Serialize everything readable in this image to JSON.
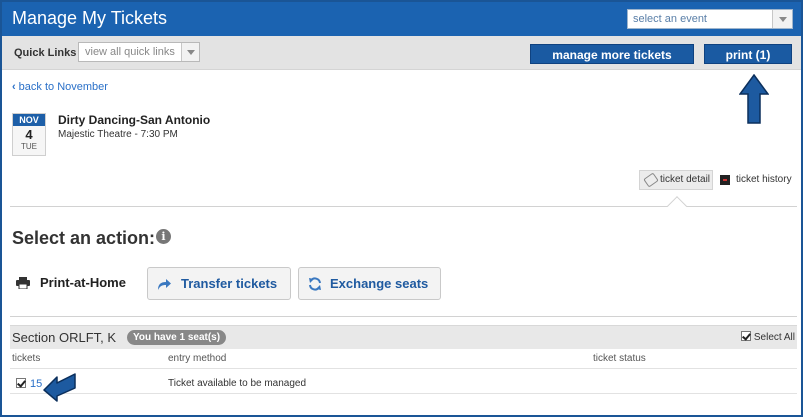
{
  "header": {
    "title": "Manage My Tickets",
    "event_select_placeholder": "select an event"
  },
  "quick_links": {
    "label": "Quick Links",
    "select_value": "view all quick links",
    "manage_button": "manage more tickets",
    "print_button": "print (1)"
  },
  "nav": {
    "back_link": "back to November"
  },
  "event": {
    "month": "NOV",
    "day": "4",
    "weekday": "TUE",
    "title": "Dirty Dancing-San Antonio",
    "venue_time": "Majestic Theatre - 7:30 PM"
  },
  "tabs": [
    {
      "label": "ticket detail",
      "active": true
    },
    {
      "label": "ticket history",
      "active": false
    }
  ],
  "actions": {
    "title": "Select an action:",
    "info_glyph": "i",
    "print_at_home": "Print-at-Home",
    "transfer": "Transfer tickets",
    "exchange": "Exchange seats"
  },
  "section": {
    "name": "Section ORLFT, K",
    "seats_badge": "You have 1 seat(s)",
    "select_all": "Select All",
    "select_all_checked": true
  },
  "table": {
    "columns": [
      "tickets",
      "entry method",
      "ticket status"
    ],
    "rows": [
      {
        "ticket": "15",
        "entry_method": "Ticket available to be managed",
        "status": "",
        "checked": true
      }
    ]
  },
  "colors": {
    "header_blue": "#1b63b1",
    "button_blue": "#1a5aa2",
    "link_blue": "#2a70c8",
    "annotation_arrow": "#1d5aa0"
  }
}
